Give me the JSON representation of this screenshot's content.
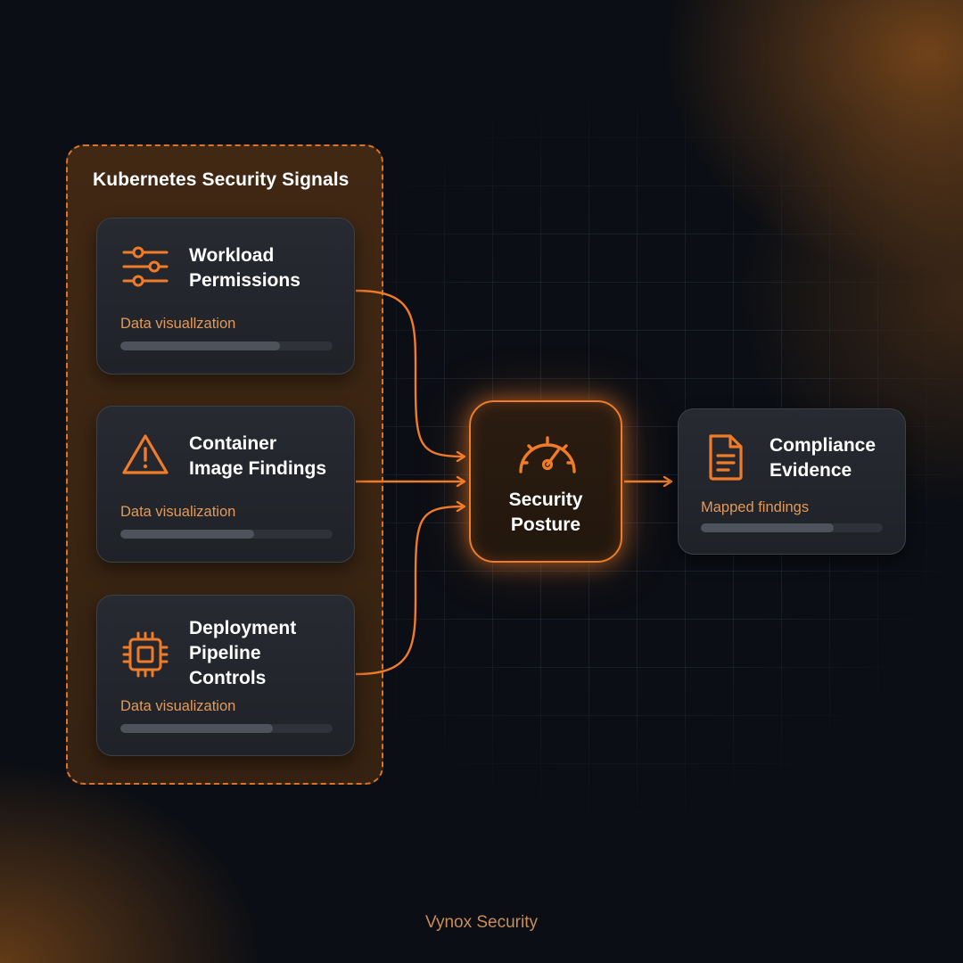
{
  "group": {
    "title": "Kubernetes Security Signals"
  },
  "signals": [
    {
      "icon": "sliders-icon",
      "title_lines": [
        "Workload",
        "Permissions"
      ],
      "subtitle": "Data visuallzation",
      "progress": 0.75
    },
    {
      "icon": "warning-triangle-icon",
      "title_lines": [
        "Container",
        "Image Findings"
      ],
      "subtitle": "Data visualization",
      "progress": 0.63
    },
    {
      "icon": "cpu-chip-icon",
      "title_lines": [
        "Deployment",
        "Pipeline",
        "Controls"
      ],
      "subtitle": "Data visualization",
      "progress": 0.72
    }
  ],
  "hub": {
    "icon": "gauge-icon",
    "title_lines": [
      "Security",
      "Posture"
    ]
  },
  "output": {
    "icon": "document-icon",
    "title_lines": [
      "Compliance",
      "Evidence"
    ],
    "subtitle": "Mapped findings",
    "progress": 0.73
  },
  "footer": {
    "brand": "Vynox Security"
  },
  "colors": {
    "accent": "#f07c2a",
    "card_bg": "#23262c",
    "group_fill": "#432916",
    "subtitle": "#e19a5b"
  }
}
